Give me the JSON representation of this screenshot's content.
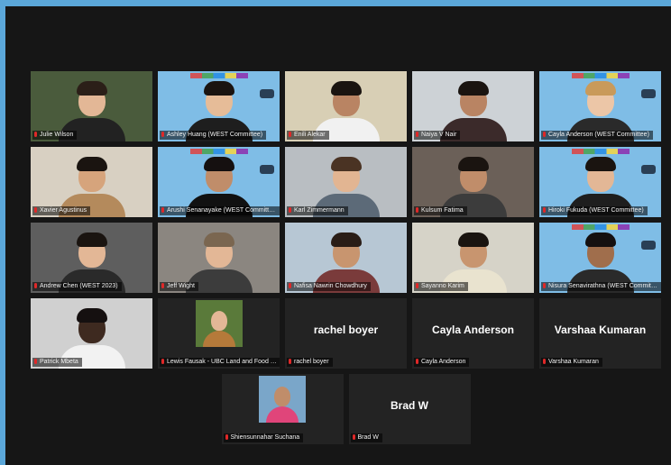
{
  "rows": [
    [
      {
        "name": "Julie Wilson",
        "video": true,
        "bg": "#4a5b3c",
        "skin": "#e3b796",
        "shirt": "#222222",
        "hair": "#2b1f18"
      },
      {
        "name": "Ashley Huang (WEST Committee)",
        "video": true,
        "bg": "#7fbde6",
        "skin": "#e6bc98",
        "shirt": "#1e1e1e",
        "hair": "#1a1410",
        "branded": true,
        "active": true
      },
      {
        "name": "Enili Alekar",
        "video": true,
        "bg": "#d8cfb5",
        "skin": "#b98463",
        "shirt": "#f1f1f1",
        "hair": "#1a1410"
      },
      {
        "name": "Naiya V Nair",
        "video": true,
        "bg": "#cdd2d6",
        "skin": "#b98463",
        "shirt": "#3b2a2a",
        "hair": "#1a1410"
      },
      {
        "name": "Cayla Anderson (WEST Committee)",
        "video": true,
        "bg": "#7fbde6",
        "skin": "#ecc6a7",
        "shirt": "#2a2a2a",
        "hair": "#c99a5a",
        "branded": true
      }
    ],
    [
      {
        "name": "Xavier Agustinus",
        "video": true,
        "bg": "#d8d0c2",
        "skin": "#d6a47c",
        "shirt": "#b48a5c",
        "hair": "#1a1410"
      },
      {
        "name": "Arushi Senanayake (WEST Committee)",
        "video": true,
        "bg": "#7fbde6",
        "skin": "#c08d6a",
        "shirt": "#111111",
        "hair": "#151010",
        "branded": true
      },
      {
        "name": "Karl Zimmermann",
        "video": true,
        "bg": "#b9bec2",
        "skin": "#e2b592",
        "shirt": "#5c6a78",
        "hair": "#4a3323"
      },
      {
        "name": "Kulsum Fatima",
        "video": true,
        "bg": "#6b6058",
        "skin": "#c08d6a",
        "shirt": "#3c3c3c",
        "hair": "#1a1410"
      },
      {
        "name": "Hiroki Fukuda (WEST Committee)",
        "video": true,
        "bg": "#7fbde6",
        "skin": "#e3b796",
        "shirt": "#1e1e1e",
        "hair": "#1a1410",
        "branded": true
      }
    ],
    [
      {
        "name": "Andrew Chen (WEST 2023)",
        "video": true,
        "bg": "#5e5e5e",
        "skin": "#e3b796",
        "shirt": "#2a2a2a",
        "hair": "#1a1410"
      },
      {
        "name": "Jeff Wight",
        "video": true,
        "bg": "#8b8680",
        "skin": "#e3b796",
        "shirt": "#3c3c3c",
        "hair": "#7a6650"
      },
      {
        "name": "Nafisa Nawrin Chowdhury",
        "video": true,
        "bg": "#b7c7d4",
        "skin": "#c8956f",
        "shirt": "#7a3b3b",
        "hair": "#2a1d16"
      },
      {
        "name": "Sayanno Karim",
        "video": true,
        "bg": "#d6d3c8",
        "skin": "#c8956f",
        "shirt": "#e9e3cf",
        "hair": "#1a1410"
      },
      {
        "name": "Nisura Senavirathna (WEST Committee)",
        "video": true,
        "bg": "#7fbde6",
        "skin": "#a06e4c",
        "shirt": "#2a2a2a",
        "hair": "#151010",
        "branded": true
      }
    ],
    [
      {
        "name": "Patrick Mbeta",
        "video": true,
        "bg": "#d0d0d0",
        "skin": "#3e2a20",
        "shirt": "#f2f2f2",
        "hair": "#151010"
      },
      {
        "name": "Lewis Fausak - UBC Land and Food Systems",
        "avatar": true
      },
      {
        "name": "rachel boyer",
        "center": "rachel boyer"
      },
      {
        "name": "Cayla Anderson",
        "center": "Cayla Anderson"
      },
      {
        "name": "Varshaa Kumaran",
        "center": "Varshaa Kumaran"
      }
    ],
    [
      {
        "name": "Shiensunnahar Suchana",
        "avatar": true,
        "pink": true
      },
      {
        "name": "Brad W",
        "center": "Brad W"
      }
    ]
  ]
}
